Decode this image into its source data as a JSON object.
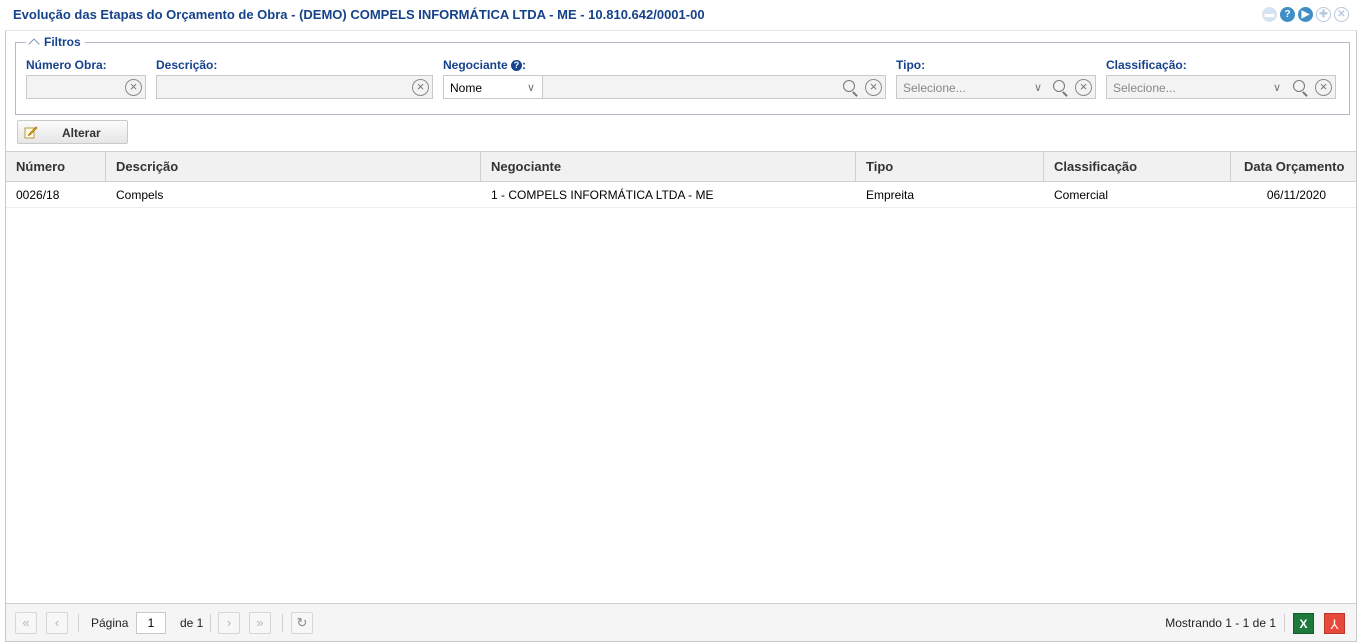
{
  "window": {
    "title": "Evolução das Etapas do Orçamento de Obra - (DEMO) COMPELS INFORMÁTICA LTDA - ME - 10.810.642/0001-00",
    "tools": [
      "minimize-icon",
      "help-icon",
      "play-icon",
      "move-icon",
      "close-icon"
    ]
  },
  "filters": {
    "legend": "Filtros",
    "numero_obra": {
      "label": "Número Obra:",
      "value": ""
    },
    "descricao": {
      "label": "Descrição:",
      "value": ""
    },
    "negociante": {
      "label": "Negociante",
      "label_suffix": ":",
      "mode": "Nome",
      "value": ""
    },
    "tipo": {
      "label": "Tipo:",
      "placeholder": "Selecione..."
    },
    "classificacao": {
      "label": "Classificação:",
      "placeholder": "Selecione..."
    }
  },
  "toolbar": {
    "alterar_label": "Alterar"
  },
  "grid": {
    "columns": [
      "Número",
      "Descrição",
      "Negociante",
      "Tipo",
      "Classificação",
      "Data Orçamento"
    ],
    "rows": [
      {
        "numero": "0026/18",
        "descricao": "Compels",
        "negociante": "1 - COMPELS INFORMÁTICA LTDA - ME",
        "tipo": "Empreita",
        "classificacao": "Comercial",
        "data": "06/11/2020"
      }
    ]
  },
  "pager": {
    "page_label": "Página",
    "page_value": "1",
    "of_label": "de 1",
    "summary": "Mostrando 1 - 1 de 1"
  },
  "colors": {
    "title": "#15428b",
    "header_bg": "#f1f1f1",
    "excel": "#1d7a3a",
    "pdf": "#e64a3b"
  }
}
